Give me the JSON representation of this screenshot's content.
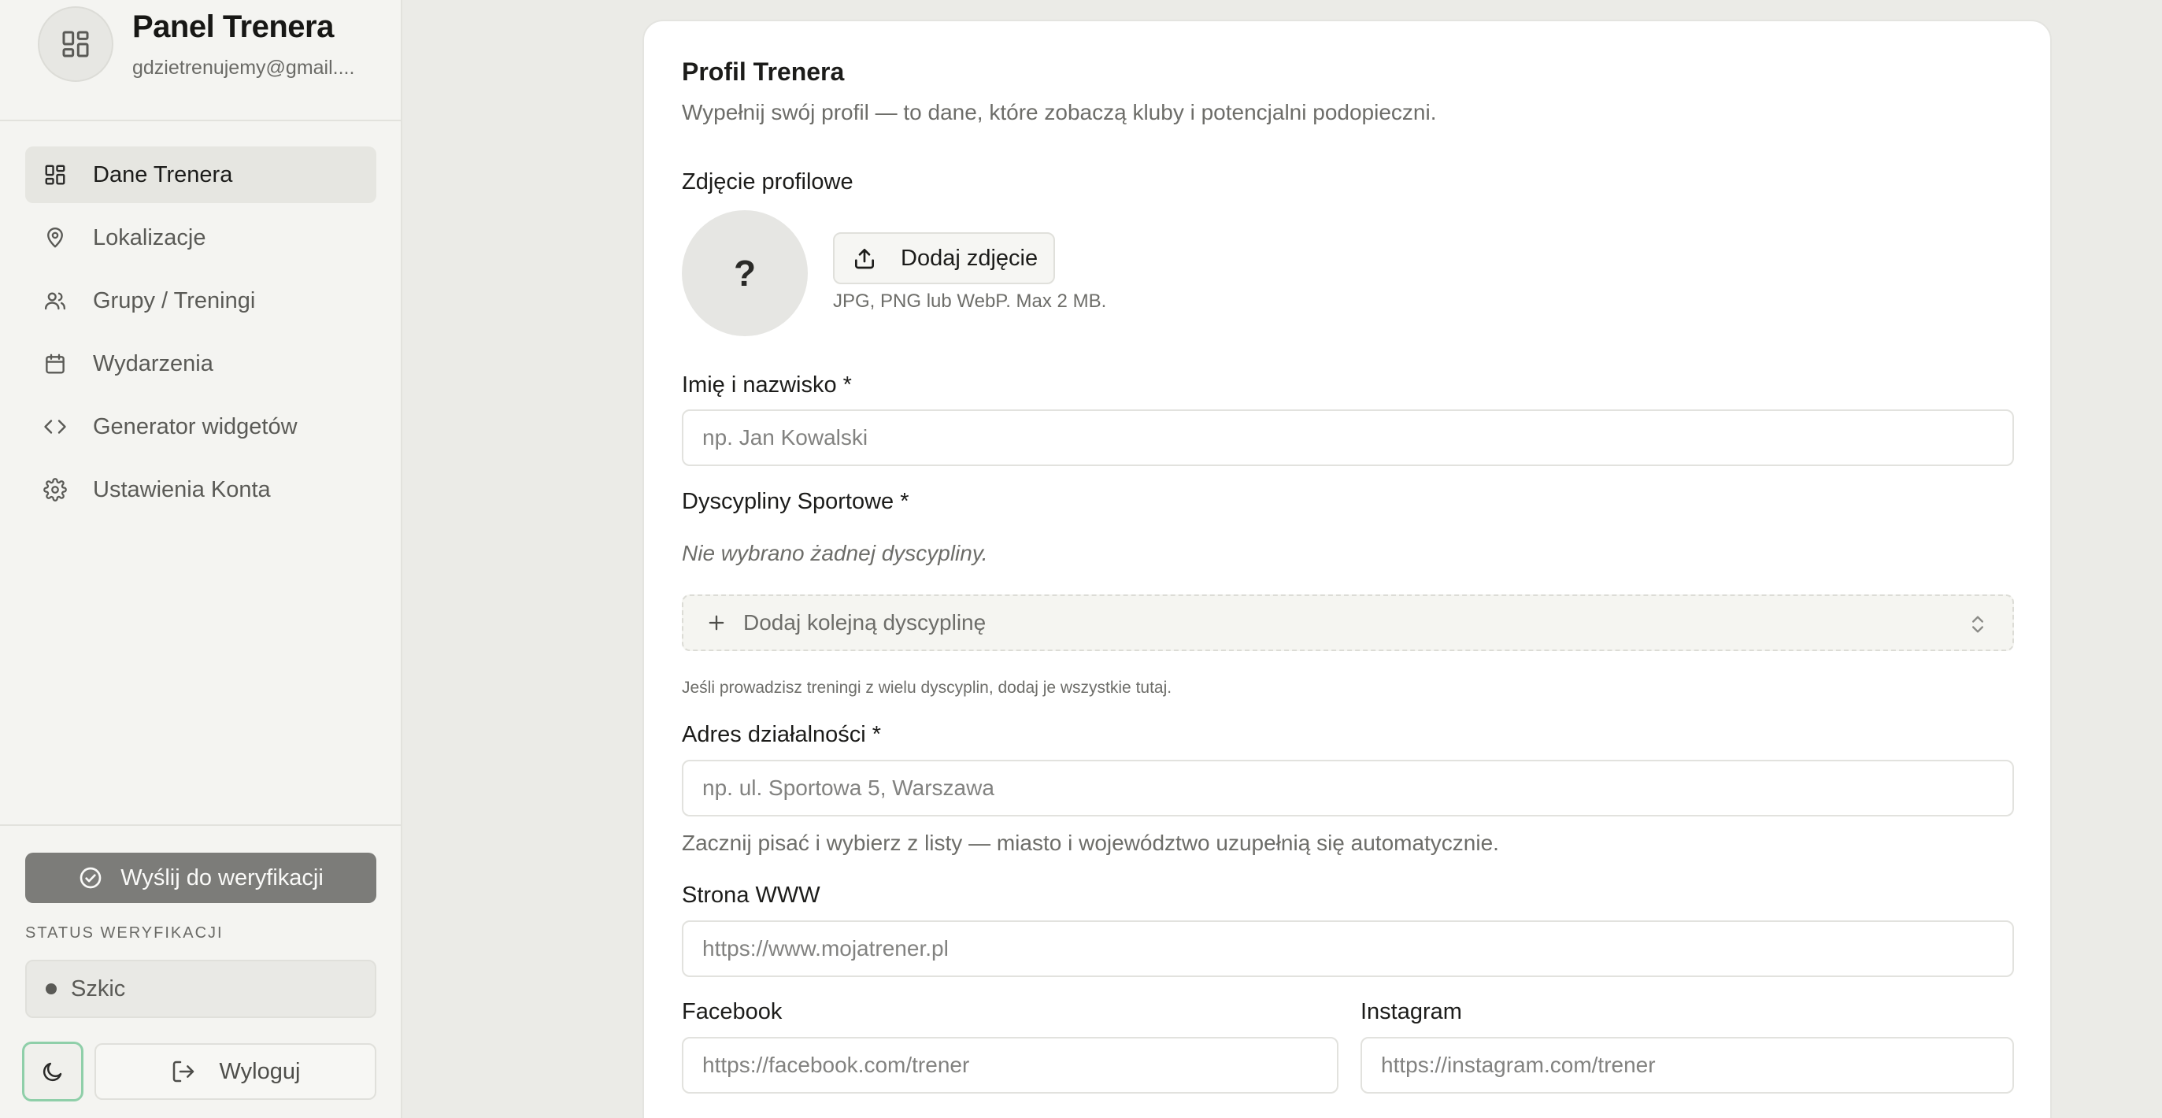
{
  "sidebar": {
    "title": "Panel Trenera",
    "email": "gdzietrenujemy@gmail....",
    "items": [
      {
        "label": "Dane Trenera",
        "icon": "dashboard-icon",
        "active": true
      },
      {
        "label": "Lokalizacje",
        "icon": "map-pin-icon",
        "active": false
      },
      {
        "label": "Grupy / Treningi",
        "icon": "users-icon",
        "active": false
      },
      {
        "label": "Wydarzenia",
        "icon": "calendar-icon",
        "active": false
      },
      {
        "label": "Generator widgetów",
        "icon": "code-icon",
        "active": false
      },
      {
        "label": "Ustawienia Konta",
        "icon": "gear-icon",
        "active": false
      }
    ],
    "verify_button": "Wyślij do weryfikacji",
    "status_label": "STATUS WERYFIKACJI",
    "status_value": "Szkic",
    "logout": "Wyloguj"
  },
  "form": {
    "title": "Profil Trenera",
    "subtitle": "Wypełnij swój profil — to dane, które zobaczą kluby i potencjalni podopieczni.",
    "photo": {
      "label": "Zdjęcie profilowe",
      "placeholder": "?",
      "upload_button": "Dodaj zdjęcie",
      "hint": "JPG, PNG lub WebP. Max 2 MB."
    },
    "name": {
      "label": "Imię i nazwisko *",
      "placeholder": "np. Jan Kowalski",
      "value": ""
    },
    "disciplines": {
      "label": "Dyscypliny Sportowe *",
      "empty": "Nie wybrano żadnej dyscypliny.",
      "add": "Dodaj kolejną dyscyplinę",
      "hint": "Jeśli prowadzisz treningi z wielu dyscyplin, dodaj je wszystkie tutaj."
    },
    "address": {
      "label": "Adres działalności *",
      "placeholder": "np. ul. Sportowa 5, Warszawa",
      "value": "",
      "hint": "Zacznij pisać i wybierz z listy — miasto i województwo uzupełnią się automatycznie."
    },
    "website": {
      "label": "Strona WWW",
      "placeholder": "https://www.mojatrener.pl",
      "value": ""
    },
    "facebook": {
      "label": "Facebook",
      "placeholder": "https://facebook.com/trener",
      "value": ""
    },
    "instagram": {
      "label": "Instagram",
      "placeholder": "https://instagram.com/trener",
      "value": ""
    }
  },
  "colors": {
    "sidebar_bg": "#f4f4f1",
    "active_item_bg": "#e6e6e1",
    "verify_button_bg": "#7c7c79",
    "theme_toggle_border": "#8fcfa9"
  }
}
